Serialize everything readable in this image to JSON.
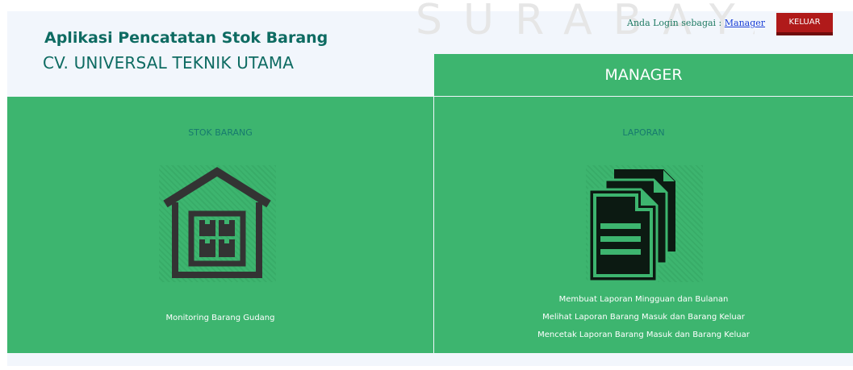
{
  "watermark": "SURABAYA",
  "header": {
    "app_title": "Aplikasi Pencatatan Stok Barang",
    "company": "CV. UNIVERSAL TEKNIK UTAMA"
  },
  "login": {
    "prefix": "Anda Login sebagai :",
    "user": "Manager",
    "logout_label": "KELUAR"
  },
  "role_title": "MANAGER",
  "panels": {
    "stok": {
      "title": "STOK BARANG",
      "icon": "warehouse-icon",
      "caption": "Monitoring Barang Gudang"
    },
    "laporan": {
      "title": "LAPORAN",
      "icon": "documents-icon",
      "items": [
        "Membuat Laporan Mingguan dan Bulanan",
        "Melihat Laporan Barang Masuk dan Barang Keluar",
        "Mencetak Laporan Barang Masuk dan Barang Keluar"
      ]
    }
  },
  "colors": {
    "panel_green": "#3db56f",
    "title_teal": "#0e6b62",
    "logout_red": "#b01a1a"
  }
}
